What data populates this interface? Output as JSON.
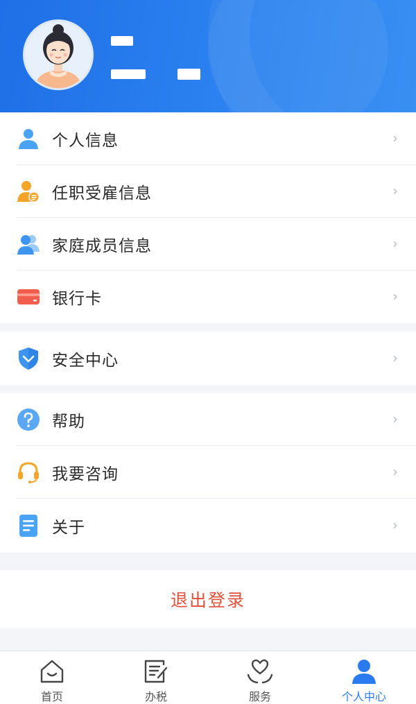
{
  "profile": {
    "avatar_icon": "woman-avatar-icon"
  },
  "menu_group_1": [
    {
      "label": "个人信息",
      "icon": "person-icon",
      "color": "#3d95f0"
    },
    {
      "label": "任职受雇信息",
      "icon": "employment-icon",
      "color": "#f5a42a"
    },
    {
      "label": "家庭成员信息",
      "icon": "family-icon",
      "color": "#3d95f0"
    },
    {
      "label": "银行卡",
      "icon": "bank-card-icon",
      "color": "#f0584a"
    }
  ],
  "menu_group_2": [
    {
      "label": "安全中心",
      "icon": "shield-icon",
      "color": "#3d95f0"
    }
  ],
  "menu_group_3": [
    {
      "label": "帮助",
      "icon": "help-icon",
      "color": "#3d95f0"
    },
    {
      "label": "我要咨询",
      "icon": "headset-icon",
      "color": "#f5a42a"
    },
    {
      "label": "关于",
      "icon": "document-icon",
      "color": "#3d95f0"
    }
  ],
  "chevron": "›",
  "logout": {
    "label": "退出登录",
    "color": "#e0503a"
  },
  "tabbar": [
    {
      "label": "首页",
      "icon": "home-icon",
      "active": false
    },
    {
      "label": "办税",
      "icon": "tax-form-icon",
      "active": false
    },
    {
      "label": "服务",
      "icon": "service-heart-icon",
      "active": false
    },
    {
      "label": "个人中心",
      "icon": "person-icon",
      "active": true
    }
  ],
  "colors": {
    "header": "#1f6fe6",
    "accent": "#2b7bf0",
    "background": "#f3f5f8"
  }
}
